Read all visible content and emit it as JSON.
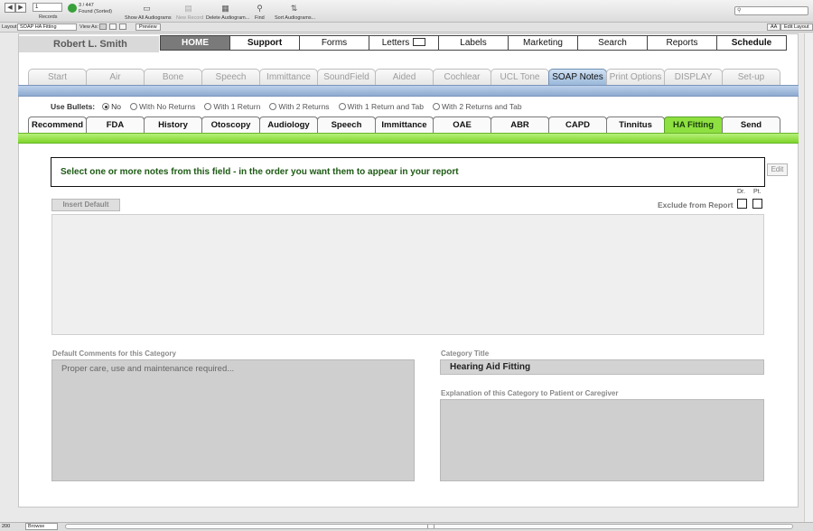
{
  "toolbar": {
    "record_number": "1",
    "records_label": "Records",
    "found_count": "3 / 447",
    "found_label": "Found (Sorted)",
    "show_all": "Show All Audiograms",
    "new_record": "New Record",
    "delete": "Delete Audiogram...",
    "find": "Find",
    "sort": "Sort Audiograms..."
  },
  "layoutbar": {
    "layout_label": "Layout:",
    "layout_value": "SOAP HA Fitting",
    "view_as": "View As:",
    "preview": "Preview",
    "aa": "AA",
    "edit_layout": "Edit Layout"
  },
  "user_name": "Robert L. Smith",
  "menu": [
    "HOME",
    "Support",
    "Forms",
    "Letters",
    "Labels",
    "Marketing",
    "Search",
    "Reports",
    "Schedule"
  ],
  "tabs_main": [
    "Start",
    "Air",
    "Bone",
    "Speech",
    "Immittance",
    "SoundField",
    "Aided",
    "Cochlear",
    "UCL Tone",
    "SOAP Notes",
    "Print Options",
    "DISPLAY",
    "Set-up"
  ],
  "bullets": {
    "label": "Use Bullets:",
    "options": [
      "No",
      "With No Returns",
      "With 1 Return",
      "With 2 Returns",
      "With 1 Return and Tab",
      "With 2 Returns and Tab"
    ]
  },
  "tabs_soap": [
    "Recommend",
    "FDA",
    "History",
    "Otoscopy",
    "Audiology",
    "Speech",
    "Immittance",
    "OAE",
    "ABR",
    "CAPD",
    "Tinnitus",
    "HA Fitting",
    "Send"
  ],
  "instruction": "Select one or more notes from this field -  in the order you want them to appear in your report",
  "edit_label": "Edit",
  "insert_default": "Insert Default",
  "exclude": {
    "label": "Exclude from Report",
    "dr": "Dr.",
    "pt": "Pt."
  },
  "comments": {
    "label": "Default Comments for this Category",
    "text": "Proper care, use and maintenance required..."
  },
  "category": {
    "title_label": "Category Title",
    "title_value": "Hearing Aid Fitting"
  },
  "explanation_label": "Explanation of this Category to Patient or Caregiver",
  "status": {
    "zoom": "200",
    "mode": "Browse"
  },
  "colors": {
    "active_soap_tab": "#8ee040",
    "active_main_tab": "#9ab8da",
    "instruction_text": "#1d5a14"
  }
}
